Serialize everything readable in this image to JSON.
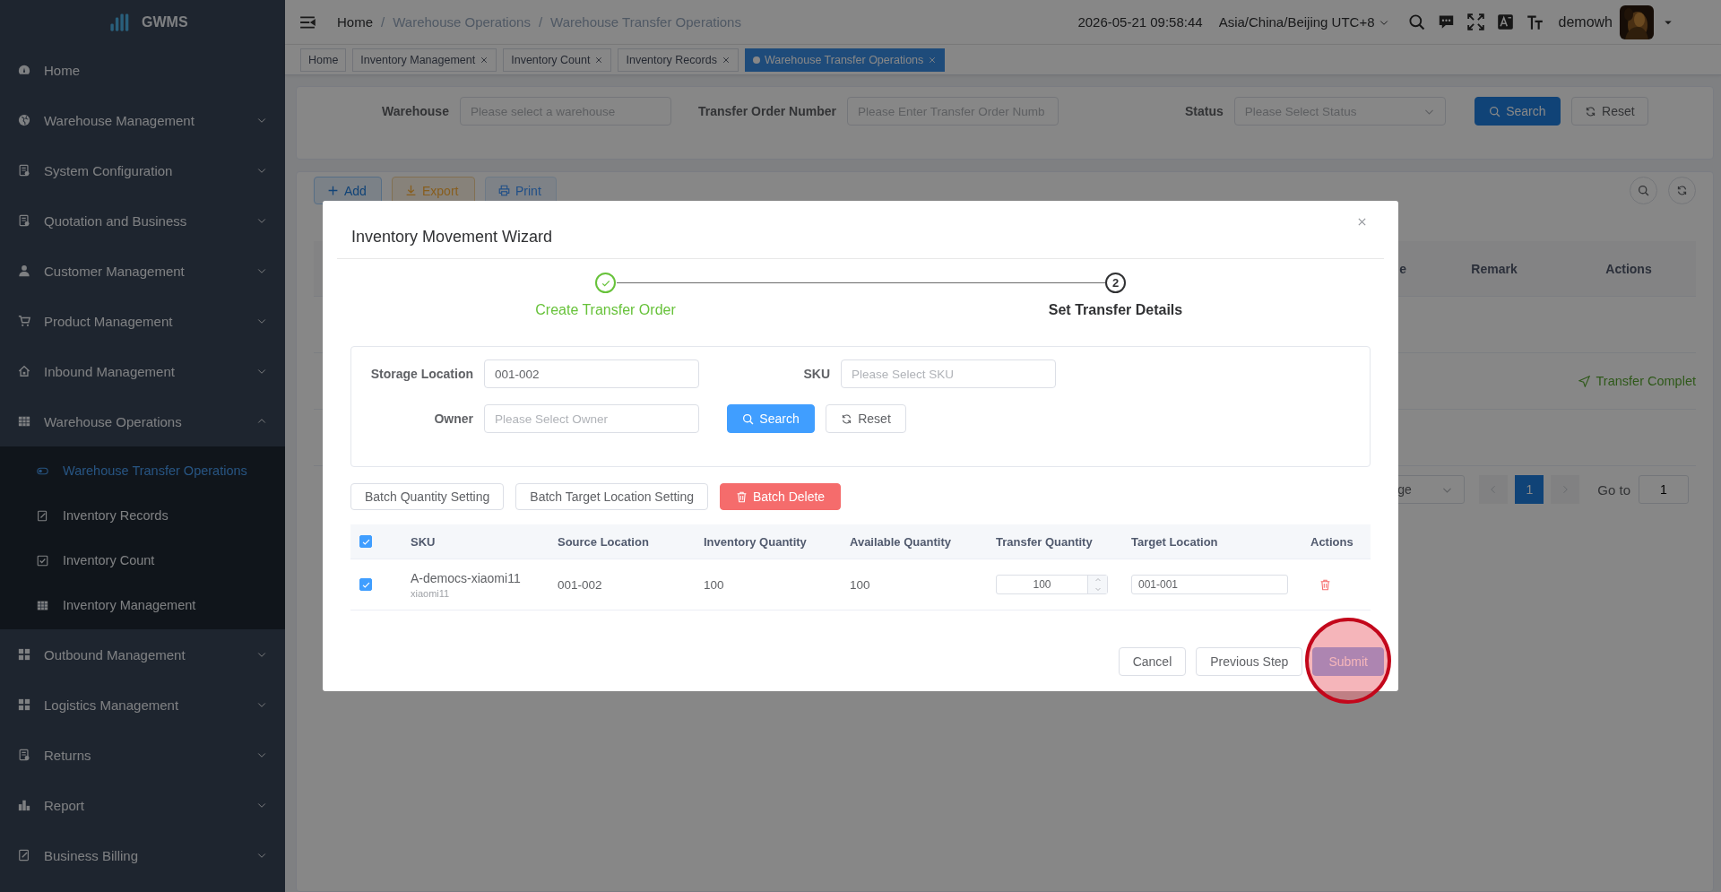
{
  "sidebar": {
    "logo": "GWMS",
    "items": [
      {
        "label": "Home"
      },
      {
        "label": "Warehouse Management",
        "expanded": false
      },
      {
        "label": "System Configuration",
        "expanded": false
      },
      {
        "label": "Quotation and Business",
        "expanded": false
      },
      {
        "label": "Customer Management",
        "expanded": false
      },
      {
        "label": "Product Management",
        "expanded": false
      },
      {
        "label": "Inbound Management",
        "expanded": false
      },
      {
        "label": "Warehouse Operations",
        "expanded": true,
        "children": [
          {
            "label": "Warehouse Transfer Operations",
            "selected": true
          },
          {
            "label": "Inventory Records",
            "selected": false
          },
          {
            "label": "Inventory Count",
            "selected": false
          },
          {
            "label": "Inventory Management",
            "selected": false
          }
        ]
      },
      {
        "label": "Outbound Management",
        "expanded": false
      },
      {
        "label": "Logistics Management",
        "expanded": false
      },
      {
        "label": "Returns",
        "expanded": false
      },
      {
        "label": "Report",
        "expanded": false
      },
      {
        "label": "Business Billing",
        "expanded": false
      }
    ]
  },
  "topbar": {
    "breadcrumb": [
      {
        "kind": "root",
        "label": "Home"
      },
      {
        "kind": "separator",
        "label": "/"
      },
      {
        "kind": "link",
        "label": "Warehouse Operations"
      },
      {
        "kind": "separator",
        "label": "/"
      },
      {
        "kind": "link",
        "label": "Warehouse Transfer Operations"
      }
    ],
    "datetime": "2026-05-21 09:58:44",
    "timezone": "Asia/China/Beijing UTC+8",
    "user": "demowh"
  },
  "tabs": [
    {
      "label": "Home",
      "selected": false,
      "closable": false
    },
    {
      "label": "Inventory Management",
      "selected": false,
      "closable": true
    },
    {
      "label": "Inventory Count",
      "selected": false,
      "closable": true
    },
    {
      "label": "Inventory Records",
      "selected": false,
      "closable": true
    },
    {
      "label": "Warehouse Transfer Operations",
      "selected": true,
      "closable": true
    }
  ],
  "filter": {
    "fields": [
      {
        "kind": "input",
        "label": "Warehouse",
        "placeholder": "Please select a warehouse"
      },
      {
        "kind": "input",
        "label": "Transfer Order Number",
        "placeholder": "Please Enter Transfer Order Numb"
      },
      {
        "kind": "select",
        "label": "Status",
        "placeholder": "Please Select Status"
      }
    ],
    "buttons": [
      {
        "kind": "primary",
        "label": "Search"
      },
      {
        "kind": "default",
        "label": "Reset"
      }
    ]
  },
  "toolbar": {
    "buttons": [
      {
        "kind": "add",
        "label": "Add"
      },
      {
        "kind": "export",
        "label": "Export"
      },
      {
        "kind": "print",
        "label": "Print"
      }
    ]
  },
  "table": {
    "columns": [
      "e",
      "Remark",
      "Actions"
    ],
    "rows": [
      {
        "action": "Transfer Complet"
      }
    ]
  },
  "pagination": {
    "page_size": "ge",
    "pages": [
      {
        "label": "1",
        "selected": true
      }
    ],
    "goto_label": "Go to",
    "goto_value": "1"
  },
  "modal": {
    "title": "Inventory Movement Wizard",
    "steps": [
      {
        "finished": true,
        "label": "Create Transfer Order"
      },
      {
        "finished": false,
        "number": "2",
        "label": "Set Transfer Details"
      }
    ],
    "form": {
      "fields": [
        {
          "label": "Storage Location",
          "value": "001-002"
        },
        {
          "label": "SKU",
          "placeholder": "Please Select SKU"
        },
        {
          "label": "Owner",
          "placeholder": "Please Select Owner"
        }
      ],
      "buttons": [
        {
          "kind": "primary",
          "label": "Search"
        },
        {
          "kind": "default",
          "label": "Reset"
        }
      ]
    },
    "batch_buttons": [
      {
        "kind": "default",
        "label": "Batch Quantity Setting"
      },
      {
        "kind": "default",
        "label": "Batch Target Location Setting"
      },
      {
        "kind": "danger",
        "label": "Batch Delete"
      }
    ],
    "table": {
      "all_checked": true,
      "columns": [
        "SKU",
        "Source Location",
        "Inventory Quantity",
        "Available Quantity",
        "Transfer Quantity",
        "Target Location",
        "Actions"
      ],
      "rows": [
        {
          "checked": true,
          "sku": "A-democs-xiaomi11",
          "sku_name": "xiaomi11",
          "source_location": "001-002",
          "inventory_quantity": "100",
          "available_quantity": "100",
          "transfer_quantity": "100",
          "target_location": "001-001"
        }
      ]
    },
    "footer": [
      {
        "kind": "default",
        "label": "Cancel",
        "highlighted": false
      },
      {
        "kind": "default",
        "label": "Previous Step",
        "highlighted": false
      },
      {
        "kind": "primary",
        "label": "Submit",
        "highlighted": true
      }
    ]
  }
}
